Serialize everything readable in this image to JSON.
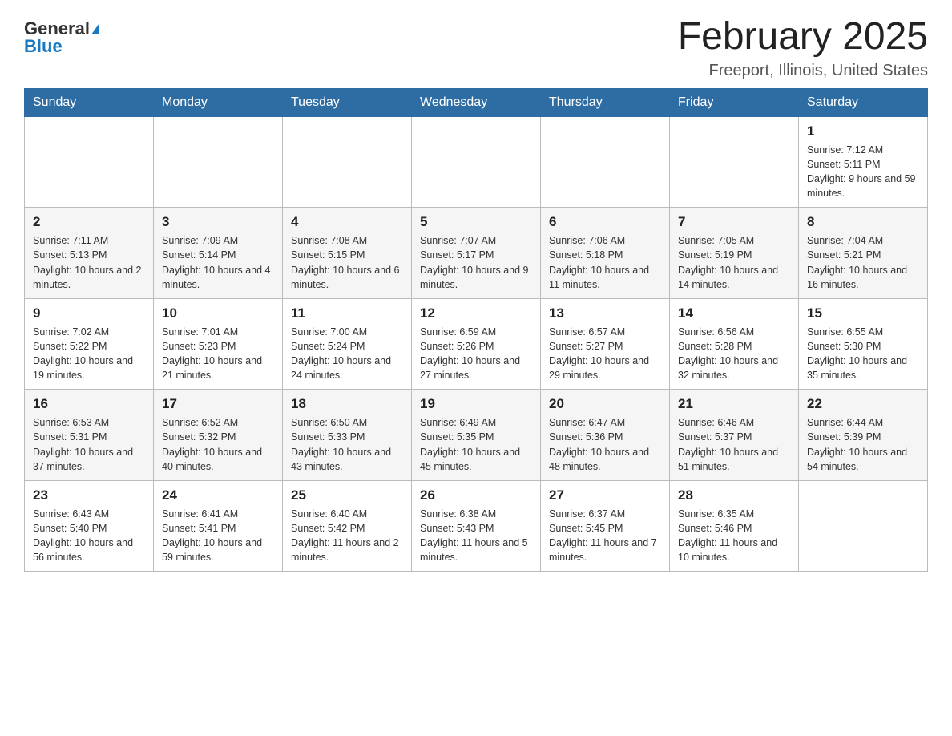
{
  "header": {
    "logo": {
      "general": "General",
      "blue": "Blue"
    },
    "title": "February 2025",
    "location": "Freeport, Illinois, United States"
  },
  "calendar": {
    "days_of_week": [
      "Sunday",
      "Monday",
      "Tuesday",
      "Wednesday",
      "Thursday",
      "Friday",
      "Saturday"
    ],
    "weeks": [
      [
        {
          "day": "",
          "info": ""
        },
        {
          "day": "",
          "info": ""
        },
        {
          "day": "",
          "info": ""
        },
        {
          "day": "",
          "info": ""
        },
        {
          "day": "",
          "info": ""
        },
        {
          "day": "",
          "info": ""
        },
        {
          "day": "1",
          "info": "Sunrise: 7:12 AM\nSunset: 5:11 PM\nDaylight: 9 hours and 59 minutes."
        }
      ],
      [
        {
          "day": "2",
          "info": "Sunrise: 7:11 AM\nSunset: 5:13 PM\nDaylight: 10 hours and 2 minutes."
        },
        {
          "day": "3",
          "info": "Sunrise: 7:09 AM\nSunset: 5:14 PM\nDaylight: 10 hours and 4 minutes."
        },
        {
          "day": "4",
          "info": "Sunrise: 7:08 AM\nSunset: 5:15 PM\nDaylight: 10 hours and 6 minutes."
        },
        {
          "day": "5",
          "info": "Sunrise: 7:07 AM\nSunset: 5:17 PM\nDaylight: 10 hours and 9 minutes."
        },
        {
          "day": "6",
          "info": "Sunrise: 7:06 AM\nSunset: 5:18 PM\nDaylight: 10 hours and 11 minutes."
        },
        {
          "day": "7",
          "info": "Sunrise: 7:05 AM\nSunset: 5:19 PM\nDaylight: 10 hours and 14 minutes."
        },
        {
          "day": "8",
          "info": "Sunrise: 7:04 AM\nSunset: 5:21 PM\nDaylight: 10 hours and 16 minutes."
        }
      ],
      [
        {
          "day": "9",
          "info": "Sunrise: 7:02 AM\nSunset: 5:22 PM\nDaylight: 10 hours and 19 minutes."
        },
        {
          "day": "10",
          "info": "Sunrise: 7:01 AM\nSunset: 5:23 PM\nDaylight: 10 hours and 21 minutes."
        },
        {
          "day": "11",
          "info": "Sunrise: 7:00 AM\nSunset: 5:24 PM\nDaylight: 10 hours and 24 minutes."
        },
        {
          "day": "12",
          "info": "Sunrise: 6:59 AM\nSunset: 5:26 PM\nDaylight: 10 hours and 27 minutes."
        },
        {
          "day": "13",
          "info": "Sunrise: 6:57 AM\nSunset: 5:27 PM\nDaylight: 10 hours and 29 minutes."
        },
        {
          "day": "14",
          "info": "Sunrise: 6:56 AM\nSunset: 5:28 PM\nDaylight: 10 hours and 32 minutes."
        },
        {
          "day": "15",
          "info": "Sunrise: 6:55 AM\nSunset: 5:30 PM\nDaylight: 10 hours and 35 minutes."
        }
      ],
      [
        {
          "day": "16",
          "info": "Sunrise: 6:53 AM\nSunset: 5:31 PM\nDaylight: 10 hours and 37 minutes."
        },
        {
          "day": "17",
          "info": "Sunrise: 6:52 AM\nSunset: 5:32 PM\nDaylight: 10 hours and 40 minutes."
        },
        {
          "day": "18",
          "info": "Sunrise: 6:50 AM\nSunset: 5:33 PM\nDaylight: 10 hours and 43 minutes."
        },
        {
          "day": "19",
          "info": "Sunrise: 6:49 AM\nSunset: 5:35 PM\nDaylight: 10 hours and 45 minutes."
        },
        {
          "day": "20",
          "info": "Sunrise: 6:47 AM\nSunset: 5:36 PM\nDaylight: 10 hours and 48 minutes."
        },
        {
          "day": "21",
          "info": "Sunrise: 6:46 AM\nSunset: 5:37 PM\nDaylight: 10 hours and 51 minutes."
        },
        {
          "day": "22",
          "info": "Sunrise: 6:44 AM\nSunset: 5:39 PM\nDaylight: 10 hours and 54 minutes."
        }
      ],
      [
        {
          "day": "23",
          "info": "Sunrise: 6:43 AM\nSunset: 5:40 PM\nDaylight: 10 hours and 56 minutes."
        },
        {
          "day": "24",
          "info": "Sunrise: 6:41 AM\nSunset: 5:41 PM\nDaylight: 10 hours and 59 minutes."
        },
        {
          "day": "25",
          "info": "Sunrise: 6:40 AM\nSunset: 5:42 PM\nDaylight: 11 hours and 2 minutes."
        },
        {
          "day": "26",
          "info": "Sunrise: 6:38 AM\nSunset: 5:43 PM\nDaylight: 11 hours and 5 minutes."
        },
        {
          "day": "27",
          "info": "Sunrise: 6:37 AM\nSunset: 5:45 PM\nDaylight: 11 hours and 7 minutes."
        },
        {
          "day": "28",
          "info": "Sunrise: 6:35 AM\nSunset: 5:46 PM\nDaylight: 11 hours and 10 minutes."
        },
        {
          "day": "",
          "info": ""
        }
      ]
    ]
  }
}
